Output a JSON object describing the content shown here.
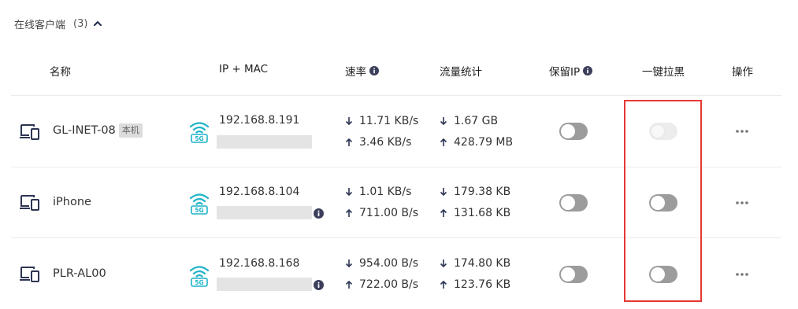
{
  "section": {
    "title": "在线客户端",
    "count": "(3)"
  },
  "headers": {
    "name": "名称",
    "ip_mac": "IP + MAC",
    "rate": "速率",
    "traffic": "流量统计",
    "keep_ip": "保留IP",
    "block": "一键拉黑",
    "action": "操作"
  },
  "devices": [
    {
      "name": "GL-INET-08",
      "tag": "本机",
      "ip": "192.168.8.191",
      "band": "5G",
      "rate_down": "11.71 KB/s",
      "rate_up": "3.46 KB/s",
      "traffic_down": "1.67 GB",
      "traffic_up": "428.79 MB",
      "keep_ip": false,
      "block": false,
      "block_disabled": true
    },
    {
      "name": "iPhone",
      "ip": "192.168.8.104",
      "band": "5G",
      "rate_down": "1.01 KB/s",
      "rate_up": "711.00 B/s",
      "traffic_down": "179.38 KB",
      "traffic_up": "131.68 KB",
      "keep_ip": false,
      "block": false,
      "block_disabled": false
    },
    {
      "name": "PLR-AL00",
      "ip": "192.168.8.168",
      "band": "5G",
      "rate_down": "954.00 B/s",
      "rate_up": "722.00 B/s",
      "traffic_down": "174.80 KB",
      "traffic_up": "123.76 KB",
      "keep_ip": false,
      "block": false,
      "block_disabled": false
    }
  ],
  "colors": {
    "wifi": "#1fb4c7",
    "highlight": "#e53935",
    "toggle_off": "#9c9c9c",
    "info_icon": "#3b3f5c"
  },
  "icons": {
    "collapse": "chevron-up-icon",
    "device": "computer-phone-icon",
    "wifi": "wifi-5g-icon",
    "info": "info-icon",
    "more": "more-dots-icon"
  }
}
